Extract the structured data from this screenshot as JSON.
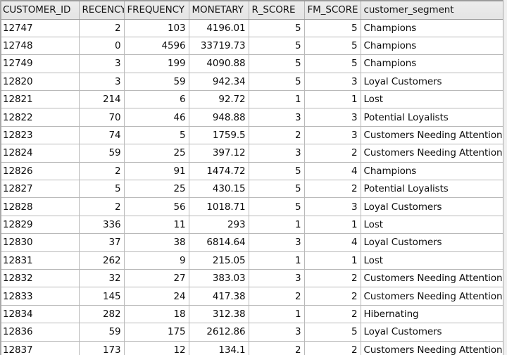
{
  "table": {
    "name": "customer-rfm-segments-grid",
    "columns": [
      {
        "key": "customer_id",
        "label": "CUSTOMER_ID",
        "align": "left"
      },
      {
        "key": "recency",
        "label": "RECENCY",
        "align": "right"
      },
      {
        "key": "frequency",
        "label": "FREQUENCY",
        "align": "right"
      },
      {
        "key": "monetary",
        "label": "MONETARY",
        "align": "right"
      },
      {
        "key": "r_score",
        "label": "R_SCORE",
        "align": "right"
      },
      {
        "key": "fm_score",
        "label": "FM_SCORE",
        "align": "right"
      },
      {
        "key": "segment",
        "label": "customer_segment",
        "align": "left"
      }
    ],
    "rows": [
      {
        "customer_id": "12747",
        "recency": "2",
        "frequency": "103",
        "monetary": "4196.01",
        "r_score": "5",
        "fm_score": "5",
        "segment": "Champions"
      },
      {
        "customer_id": "12748",
        "recency": "0",
        "frequency": "4596",
        "monetary": "33719.73",
        "r_score": "5",
        "fm_score": "5",
        "segment": "Champions"
      },
      {
        "customer_id": "12749",
        "recency": "3",
        "frequency": "199",
        "monetary": "4090.88",
        "r_score": "5",
        "fm_score": "5",
        "segment": "Champions"
      },
      {
        "customer_id": "12820",
        "recency": "3",
        "frequency": "59",
        "monetary": "942.34",
        "r_score": "5",
        "fm_score": "3",
        "segment": "Loyal Customers"
      },
      {
        "customer_id": "12821",
        "recency": "214",
        "frequency": "6",
        "monetary": "92.72",
        "r_score": "1",
        "fm_score": "1",
        "segment": "Lost"
      },
      {
        "customer_id": "12822",
        "recency": "70",
        "frequency": "46",
        "monetary": "948.88",
        "r_score": "3",
        "fm_score": "3",
        "segment": "Potential Loyalists"
      },
      {
        "customer_id": "12823",
        "recency": "74",
        "frequency": "5",
        "monetary": "1759.5",
        "r_score": "2",
        "fm_score": "3",
        "segment": "Customers Needing Attention"
      },
      {
        "customer_id": "12824",
        "recency": "59",
        "frequency": "25",
        "monetary": "397.12",
        "r_score": "3",
        "fm_score": "2",
        "segment": "Customers Needing Attention"
      },
      {
        "customer_id": "12826",
        "recency": "2",
        "frequency": "91",
        "monetary": "1474.72",
        "r_score": "5",
        "fm_score": "4",
        "segment": "Champions"
      },
      {
        "customer_id": "12827",
        "recency": "5",
        "frequency": "25",
        "monetary": "430.15",
        "r_score": "5",
        "fm_score": "2",
        "segment": "Potential Loyalists"
      },
      {
        "customer_id": "12828",
        "recency": "2",
        "frequency": "56",
        "monetary": "1018.71",
        "r_score": "5",
        "fm_score": "3",
        "segment": "Loyal Customers"
      },
      {
        "customer_id": "12829",
        "recency": "336",
        "frequency": "11",
        "monetary": "293",
        "r_score": "1",
        "fm_score": "1",
        "segment": "Lost"
      },
      {
        "customer_id": "12830",
        "recency": "37",
        "frequency": "38",
        "monetary": "6814.64",
        "r_score": "3",
        "fm_score": "4",
        "segment": "Loyal Customers"
      },
      {
        "customer_id": "12831",
        "recency": "262",
        "frequency": "9",
        "monetary": "215.05",
        "r_score": "1",
        "fm_score": "1",
        "segment": "Lost"
      },
      {
        "customer_id": "12832",
        "recency": "32",
        "frequency": "27",
        "monetary": "383.03",
        "r_score": "3",
        "fm_score": "2",
        "segment": "Customers Needing Attention"
      },
      {
        "customer_id": "12833",
        "recency": "145",
        "frequency": "24",
        "monetary": "417.38",
        "r_score": "2",
        "fm_score": "2",
        "segment": "Customers Needing Attention"
      },
      {
        "customer_id": "12834",
        "recency": "282",
        "frequency": "18",
        "monetary": "312.38",
        "r_score": "1",
        "fm_score": "2",
        "segment": "Hibernating"
      },
      {
        "customer_id": "12836",
        "recency": "59",
        "frequency": "175",
        "monetary": "2612.86",
        "r_score": "3",
        "fm_score": "5",
        "segment": "Loyal Customers"
      },
      {
        "customer_id": "12837",
        "recency": "173",
        "frequency": "12",
        "monetary": "134.1",
        "r_score": "2",
        "fm_score": "2",
        "segment": "Customers Needing Attention"
      }
    ]
  },
  "colors": {
    "header_background": "#e9e9e9",
    "grid_line": "#b9b9b9",
    "text": "#0e0e0e",
    "cell_background": "#ffffff"
  }
}
